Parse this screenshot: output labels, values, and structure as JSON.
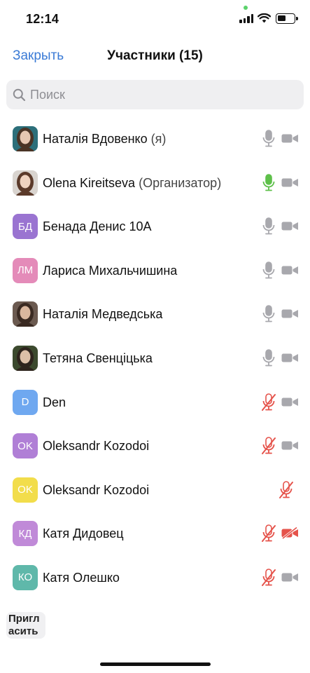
{
  "status_bar": {
    "time": "12:14"
  },
  "header": {
    "close_label": "Закрыть",
    "title": "Участники (15)"
  },
  "search": {
    "placeholder": "Поиск",
    "value": ""
  },
  "participants": [
    {
      "name": "Наталія Вдовенко",
      "suffix": " (я)",
      "avatar": {
        "type": "photo",
        "hair": "#4a3426",
        "skin": "#e6c7b2",
        "bg": "#2c6f7a"
      },
      "mic": "on",
      "video": "on"
    },
    {
      "name": "Olena Kireitseva",
      "suffix": " (Организатор)",
      "avatar": {
        "type": "photo",
        "hair": "#5b3a2a",
        "skin": "#efd3c0",
        "bg": "#d9d4cf"
      },
      "mic": "speaking",
      "video": "on"
    },
    {
      "name": "Бенада Денис 10А",
      "suffix": "",
      "avatar": {
        "type": "initials",
        "text": "БД",
        "color": "#9a74d1"
      },
      "mic": "on",
      "video": "on"
    },
    {
      "name": "Лариса Михальчишина",
      "suffix": "",
      "avatar": {
        "type": "initials",
        "text": "ЛМ",
        "color": "#e48bb9"
      },
      "mic": "on",
      "video": "on"
    },
    {
      "name": "Наталія Медведська",
      "suffix": "",
      "avatar": {
        "type": "photo",
        "hair": "#3a2a22",
        "skin": "#d9b79e",
        "bg": "#6b5a50"
      },
      "mic": "on",
      "video": "on"
    },
    {
      "name": "Тетяна Свенціцька",
      "suffix": "",
      "avatar": {
        "type": "photo",
        "hair": "#2e241d",
        "skin": "#dcbfa7",
        "bg": "#3c4a2e"
      },
      "mic": "on",
      "video": "on"
    },
    {
      "name": "Den",
      "suffix": "",
      "avatar": {
        "type": "initials",
        "text": "D",
        "color": "#6fa8f0"
      },
      "mic": "muted",
      "video": "on"
    },
    {
      "name": "Oleksandr Kozodoi",
      "suffix": "",
      "avatar": {
        "type": "initials",
        "text": "OK",
        "color": "#b07fd6"
      },
      "mic": "muted",
      "video": "on"
    },
    {
      "name": "Oleksandr Kozodoi",
      "suffix": "",
      "avatar": {
        "type": "initials",
        "text": "OK",
        "color": "#f2dd4b"
      },
      "mic": "muted",
      "video": "none"
    },
    {
      "name": "Катя Дидовец",
      "suffix": "",
      "avatar": {
        "type": "initials",
        "text": "КД",
        "color": "#c08ad8"
      },
      "mic": "muted",
      "video": "off"
    },
    {
      "name": "Катя Олешко",
      "suffix": "",
      "avatar": {
        "type": "initials",
        "text": "КО",
        "color": "#5fb8aa"
      },
      "mic": "muted",
      "video": "on"
    }
  ],
  "footer": {
    "invite_label_line1": "Пригл",
    "invite_label_line2": "асить"
  },
  "colors": {
    "accent": "#3b7bd6",
    "icon_gray": "#a8a8ad",
    "mic_speaking": "#5ec04a",
    "muted_red": "#e5534b"
  }
}
